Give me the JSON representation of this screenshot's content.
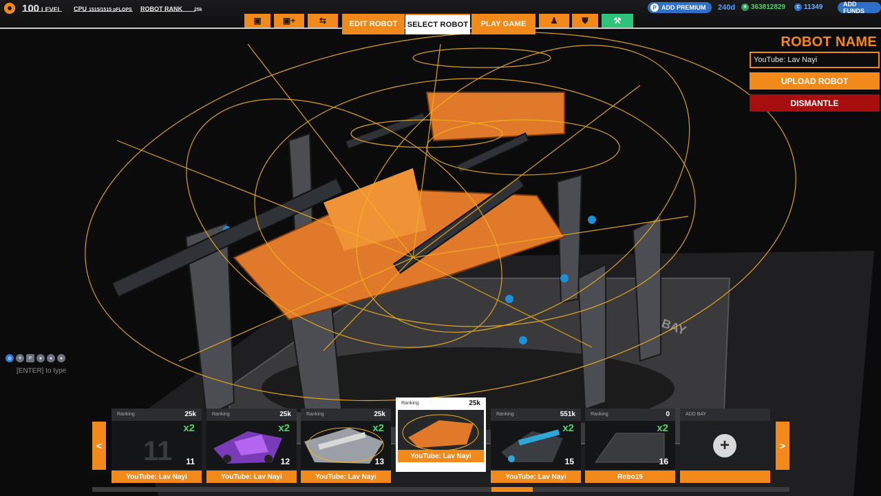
{
  "topbar": {
    "level_value": "100",
    "level_label": "LEVEL",
    "cpu_label": "CPU",
    "cpu_value": "1515/1515 pFLOPS",
    "rank_label": "ROBOT RANK",
    "rank_value": "25k",
    "tabs": {
      "edit": "EDIT ROBOT",
      "select": "SELECT ROBOT",
      "play": "PLAY GAME"
    },
    "add_premium": "ADD PREMIUM",
    "premium_days": "240d",
    "robits": "363812829",
    "cosmetic_credits": "11349",
    "add_funds": "ADD FUNDS"
  },
  "side": {
    "title": "ROBOT NAME",
    "name_value": "YouTube: Lav Nayi",
    "upload": "UPLOAD ROBOT",
    "dismantle": "DISMANTLE"
  },
  "chat": {
    "hint": "[ENTER] to type"
  },
  "garage": {
    "prev": "<",
    "next": ">",
    "ranking_label": "Ranking",
    "add_bay": "ADD BAY",
    "bays": [
      {
        "rank": "25k",
        "mult": "x2",
        "num": "11",
        "name": "YouTube: Lav Nayi",
        "placeholder": "11"
      },
      {
        "rank": "25k",
        "mult": "x2",
        "num": "12",
        "name": "YouTube: Lav Nayi"
      },
      {
        "rank": "25k",
        "mult": "x2",
        "num": "13",
        "name": "YouTube: Lav Nayi"
      },
      {
        "rank": "25k",
        "name": "YouTube: Lav Nayi"
      },
      {
        "rank": "551k",
        "mult": "x2",
        "num": "15",
        "name": "YouTube: Lav Nayi"
      },
      {
        "rank": "0",
        "mult": "x2",
        "num": "16",
        "name": "Robo16"
      }
    ]
  },
  "colors": {
    "accent": "#f28a1b",
    "danger": "#a70e0e",
    "premium_blue": "#2e6fc8",
    "bonus_green": "#4fd36b"
  },
  "icons": [
    "gear-icon",
    "cube-icon",
    "cube-plus-icon",
    "connector-icon",
    "avatar-icon",
    "shield-icon",
    "garage-icon",
    "premium-icon",
    "robits-icon",
    "cosmetic-credits-icon",
    "globe-icon",
    "plus-icon"
  ]
}
